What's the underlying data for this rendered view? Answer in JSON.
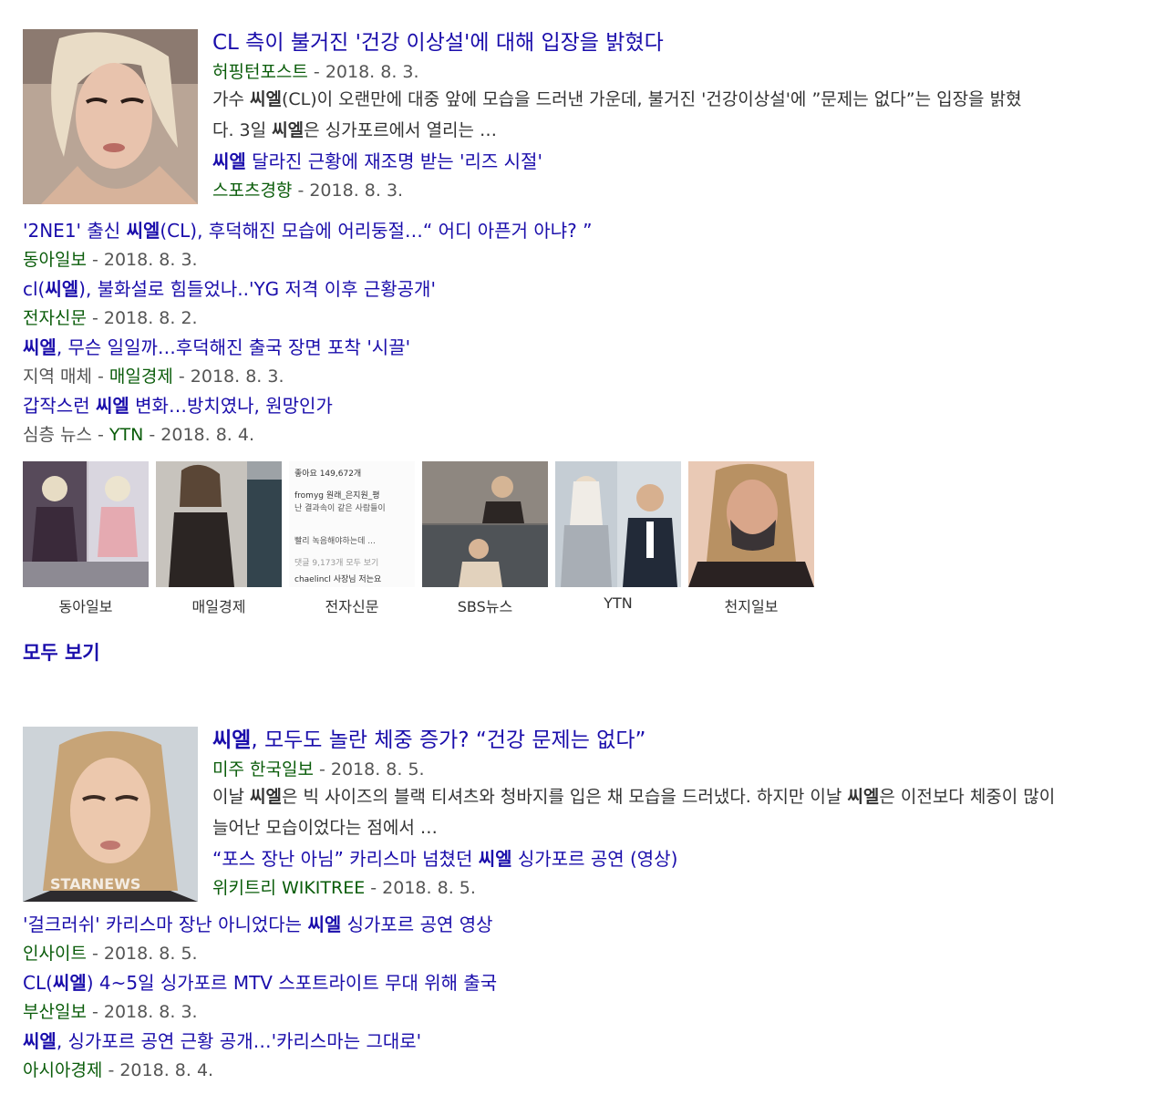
{
  "cluster1": {
    "lead": {
      "title_pre": "CL 측이 불거진 '건강 이상설'에 대해 입장을 밝혔다",
      "source": "허핑턴포스트",
      "date": " - 2018. 8. 3.",
      "snippet_a": "가수 ",
      "snippet_b": "씨엘",
      "snippet_c": "(CL)이 오랜만에 대중 앞에 모습을 드러낸 가운데, 불거진 '건강이상설'에 ”문제는 없다”는 입장을 밝혔다. 3일 ",
      "snippet_d": "씨엘",
      "snippet_e": "은 싱가포르에서 열리는 …"
    },
    "sub": {
      "bold": "씨엘",
      "rest": " 달라진 근황에 재조명 받는 '리즈 시절'",
      "source": "스포츠경향",
      "date": " - 2018. 8. 3."
    },
    "items": [
      {
        "pre": "'2NE1' 출신 ",
        "bold": "씨엘",
        "post": "(CL), 후덕해진 모습에 어리둥절…“ 어디 아픈거 아냐? ”",
        "prefix": "",
        "source": "동아일보",
        "date": " - 2018. 8. 3."
      },
      {
        "pre": "cl(",
        "bold": "씨엘",
        "post": "), 불화설로 힘들었나..'YG 저격 이후 근황공개'",
        "prefix": "",
        "source": "전자신문",
        "date": " - 2018. 8. 2."
      },
      {
        "pre": "",
        "bold": "씨엘",
        "post": ", 무슨 일일까…후덕해진 출국 장면 포착 '시끌'",
        "prefix": "지역 매체 - ",
        "source": "매일경제",
        "date": " - 2018. 8. 3."
      },
      {
        "pre": "갑작스런 ",
        "bold": "씨엘",
        "post": " 변화…방치였나, 원망인가",
        "prefix": "심층 뉴스 - ",
        "source": "YTN",
        "date": " - 2018. 8. 4."
      }
    ],
    "strip": [
      {
        "caption": "동아일보"
      },
      {
        "caption": "매일경제"
      },
      {
        "caption": "전자신문",
        "lines": [
          "좋아요 149,672개",
          "fromyg 원래_은지원_평",
          "난 결과속이 같은 사람들이",
          "빨리 녹음해야하는데 ...",
          "댓글 9,173개 모두 보기",
          "chaelincl 사장님 저는요"
        ]
      },
      {
        "caption": "SBS뉴스"
      },
      {
        "caption": "YTN"
      },
      {
        "caption": "천지일보"
      }
    ],
    "see_all": "모두 보기"
  },
  "cluster2": {
    "lead": {
      "title_bold": "씨엘",
      "title_rest": ", 모두도 놀란 체중 증가? “건강 문제는 없다”",
      "source": "미주 한국일보",
      "date": " - 2018. 8. 5.",
      "snippet_a": "이날 ",
      "snippet_b": "씨엘",
      "snippet_c": "은 빅 사이즈의 블랙 티셔츠와 청바지를 입은 채 모습을 드러냈다. 하지만 이날 ",
      "snippet_d": "씨엘",
      "snippet_e": "은 이전보다 체중이 많이 늘어난 모습이었다는 점에서 …",
      "watermark": "STARNEWS"
    },
    "sub": {
      "pre": "“포스 장난 아님” 카리스마 넘쳤던 ",
      "bold": "씨엘",
      "post": " 싱가포르 공연 (영상)",
      "source": "위키트리 WIKITREE",
      "date": " - 2018. 8. 5."
    },
    "items": [
      {
        "pre": "'걸크러쉬' 카리스마 장난 아니었다는 ",
        "bold": "씨엘",
        "post": " 싱가포르 공연 영상",
        "source": "인사이트",
        "date": " - 2018. 8. 5."
      },
      {
        "pre": "CL(",
        "bold": "씨엘",
        "post": ") 4~5일 싱가포르 MTV 스포트라이트 무대 위해 출국",
        "source": "부산일보",
        "date": " - 2018. 8. 3."
      },
      {
        "pre": "",
        "bold": "씨엘",
        "post": ", 싱가포르 공연 근황 공개…'카리스마는 그대로'",
        "source": "아시아경제",
        "date": " - 2018. 8. 4."
      }
    ]
  }
}
